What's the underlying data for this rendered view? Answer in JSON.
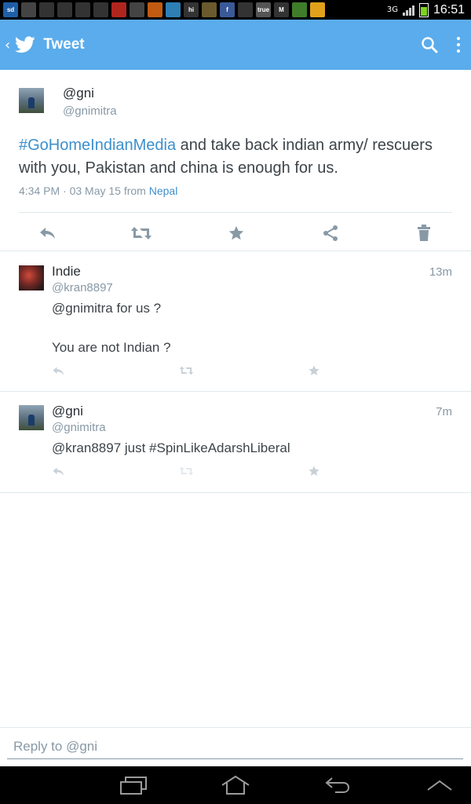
{
  "status_bar": {
    "network": "3G",
    "time": "16:51",
    "notification_icons": [
      {
        "name": "sd-icon",
        "label": "sd",
        "color": "#1f5fa8"
      },
      {
        "name": "edit-icon",
        "label": "",
        "color": "#444444"
      },
      {
        "name": "twitter-icon",
        "label": "",
        "color": "#333333"
      },
      {
        "name": "hike-icon",
        "label": "",
        "color": "#333333"
      },
      {
        "name": "gmail-icon",
        "label": "",
        "color": "#333333"
      },
      {
        "name": "glasses-icon",
        "label": "",
        "color": "#333333"
      },
      {
        "name": "news-icon",
        "label": "",
        "color": "#b0261d"
      },
      {
        "name": "saavn-icon",
        "label": "",
        "color": "#444444"
      },
      {
        "name": "news-app-icon",
        "label": "",
        "color": "#c15b11"
      },
      {
        "name": "chat-icon",
        "label": "",
        "color": "#2d7fb5"
      },
      {
        "name": "hi-icon",
        "label": "hi",
        "color": "#333333"
      },
      {
        "name": "notification-icon",
        "label": "",
        "color": "#6b5a2e"
      },
      {
        "name": "facebook-icon",
        "label": "f",
        "color": "#3b5998"
      },
      {
        "name": "mail-icon",
        "label": "",
        "color": "#333333"
      },
      {
        "name": "truecaller-icon",
        "label": "true",
        "color": "#555555"
      },
      {
        "name": "m-icon",
        "label": "M",
        "color": "#333333"
      },
      {
        "name": "playstore-icon",
        "label": "",
        "color": "#3f7d2a"
      },
      {
        "name": "ring-icon",
        "label": "",
        "color": "#e1a11b"
      }
    ]
  },
  "app_bar": {
    "title": "Tweet",
    "background": "#5aacec"
  },
  "main_tweet": {
    "author_name": "@gni",
    "author_handle": "@gnimitra",
    "hashtag": "#GoHomeIndianMedia",
    "text_rest": " and take back indian army/ rescuers with you, Pakistan and china is enough for us.",
    "time": "4:34 PM · 03 May 15 from ",
    "place": "Nepal",
    "actions": [
      "reply-icon",
      "retweet-icon",
      "favorite-icon",
      "share-icon",
      "delete-icon"
    ]
  },
  "replies": [
    {
      "name": "Indie",
      "handle": "@kran8897",
      "time": "13m",
      "text": "@gnimitra for us ?\n\nYou are not Indian ?"
    },
    {
      "name": "@gni",
      "handle": "@gnimitra",
      "time": "7m",
      "text": "@kran8897 just #SpinLikeAdarshLiberal"
    }
  ],
  "reply_bar": {
    "placeholder": "Reply to @gni"
  },
  "colors": {
    "accent": "#5aacec",
    "link": "#3d8fcc",
    "muted": "#8899a6"
  }
}
